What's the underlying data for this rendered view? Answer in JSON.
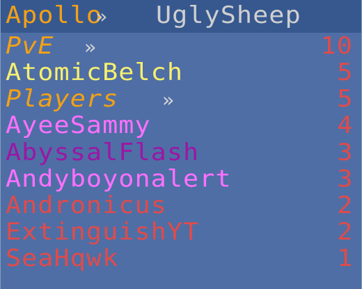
{
  "header": {
    "left": "Apollo",
    "separator": "»",
    "right": "UglySheep"
  },
  "rows": [
    {
      "name": "PvE",
      "score": "10",
      "name_color": "#f3a116",
      "score_color": "#e04b4b",
      "italic": true,
      "chevron": "»"
    },
    {
      "name": "AtomicBelch",
      "score": "5",
      "name_color": "#f7f06e",
      "score_color": "#e04b4b"
    },
    {
      "name": "Players",
      "score": "5",
      "name_color": "#f3a116",
      "score_color": "#e04b4b",
      "italic": true,
      "chevron": "»"
    },
    {
      "name": "AyeeSammy",
      "score": "4",
      "name_color": "#ff70ff",
      "score_color": "#e04b4b"
    },
    {
      "name": "AbyssalFlash",
      "score": "3",
      "name_color": "#9b17a6",
      "score_color": "#e04b4b"
    },
    {
      "name": "Andyboyonalert",
      "score": "3",
      "name_color": "#ff70ff",
      "score_color": "#e04b4b"
    },
    {
      "name": "Andronicus",
      "score": "2",
      "name_color": "#e04b4b",
      "score_color": "#e04b4b"
    },
    {
      "name": "ExtinguishYT",
      "score": "2",
      "name_color": "#e04b4b",
      "score_color": "#e04b4b"
    },
    {
      "name": "SeaHqwk",
      "score": "1",
      "name_color": "#e04b4b",
      "score_color": "#e04b4b"
    }
  ]
}
